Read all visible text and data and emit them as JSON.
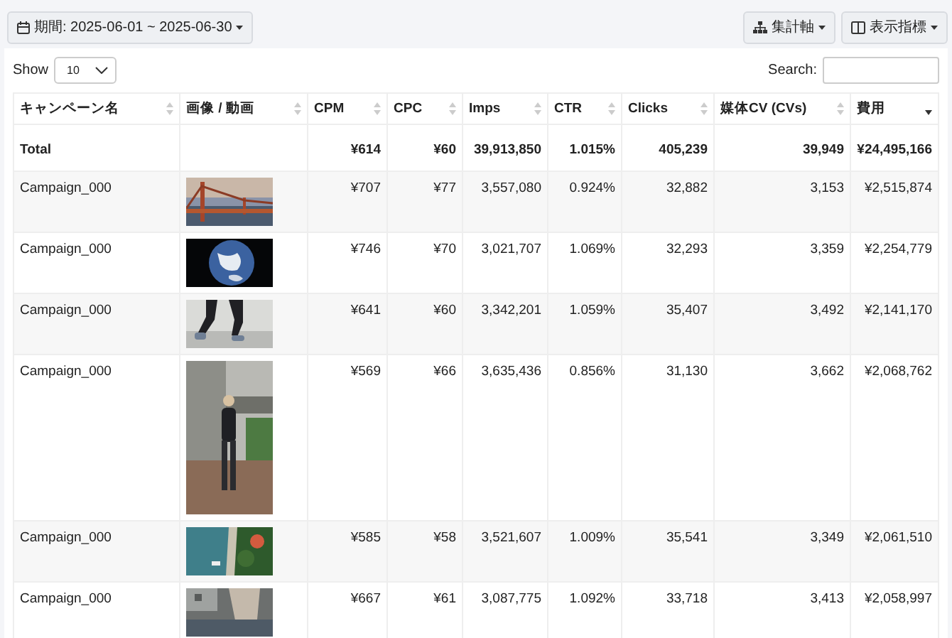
{
  "toolbar": {
    "period_button": "期間: 2025-06-01 ~ 2025-06-30",
    "buttons": [
      "集計軸",
      "表示指標"
    ]
  },
  "length": {
    "label": "Show",
    "value": "10"
  },
  "search": {
    "label": "Search:"
  },
  "table": {
    "columns": [
      {
        "label": "キャンペーン名",
        "sorted": false
      },
      {
        "label": "画像 / 動画",
        "sorted": false
      },
      {
        "label": "CPM",
        "sorted": false
      },
      {
        "label": "CPC",
        "sorted": false
      },
      {
        "label": "Imps",
        "sorted": false
      },
      {
        "label": "CTR",
        "sorted": false
      },
      {
        "label": "Clicks",
        "sorted": false
      },
      {
        "label": "媒体CV (CVs)",
        "sorted": false
      },
      {
        "label": "費用",
        "sorted": true
      }
    ],
    "total": {
      "label": "Total",
      "values": [
        "¥614",
        "¥60",
        "39,913,850",
        "1.015%",
        "405,239",
        "39,949",
        "¥24,495,166"
      ]
    },
    "rows": [
      {
        "name": "Campaign_000",
        "media": {
          "kind": "picture",
          "portrait": false
        },
        "values": [
          "¥707",
          "¥77",
          "3,557,080",
          "0.924%",
          "32,882",
          "3,153",
          "¥2,515,874"
        ]
      },
      {
        "name": "Campaign_000",
        "media": {
          "kind": "picture",
          "portrait": false
        },
        "values": [
          "¥746",
          "¥70",
          "3,021,707",
          "1.069%",
          "32,293",
          "3,359",
          "¥2,254,779"
        ]
      },
      {
        "name": "Campaign_000",
        "media": {
          "kind": "picture",
          "portrait": false
        },
        "values": [
          "¥641",
          "¥60",
          "3,342,201",
          "1.059%",
          "35,407",
          "3,492",
          "¥2,141,170"
        ]
      },
      {
        "name": "Campaign_000",
        "media": {
          "kind": "picture",
          "portrait": true
        },
        "values": [
          "¥569",
          "¥66",
          "3,635,436",
          "0.856%",
          "31,130",
          "3,662",
          "¥2,068,762"
        ]
      },
      {
        "name": "Campaign_000",
        "media": {
          "kind": "picture",
          "portrait": false
        },
        "values": [
          "¥585",
          "¥58",
          "3,521,607",
          "1.009%",
          "35,541",
          "3,349",
          "¥2,061,510"
        ]
      },
      {
        "name": "Campaign_000",
        "media": {
          "kind": "picture",
          "portrait": false
        },
        "values": [
          "¥667",
          "¥61",
          "3,087,775",
          "1.092%",
          "33,718",
          "3,413",
          "¥2,058,997"
        ]
      }
    ]
  }
}
